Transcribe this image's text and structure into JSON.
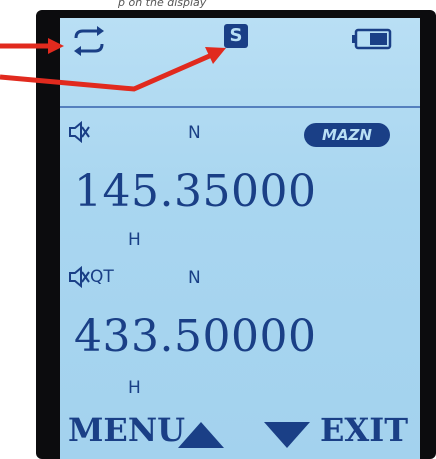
{
  "caption": {
    "text": "p on the display"
  },
  "status_bar": {
    "loop_icon": "repeat-icon",
    "s_indicator": "S",
    "battery_icon": "battery-icon"
  },
  "vfo_a": {
    "mute_icon": "speaker-muted-icon",
    "mode_letter": "N",
    "badge": "MAZN",
    "frequency": "145.35000",
    "power": "H"
  },
  "vfo_b": {
    "mute_icon": "speaker-muted-icon",
    "tone_label": "QT",
    "mode_letter": "N",
    "frequency": "433.50000",
    "power": "H"
  },
  "softkeys": {
    "left": "MENU",
    "right": "EXIT"
  },
  "colors": {
    "lcd_background": "#aad7f1",
    "lcd_foreground": "#1a3f86",
    "bezel": "#0c0c0e",
    "annotation_red": "#e12a1e"
  }
}
